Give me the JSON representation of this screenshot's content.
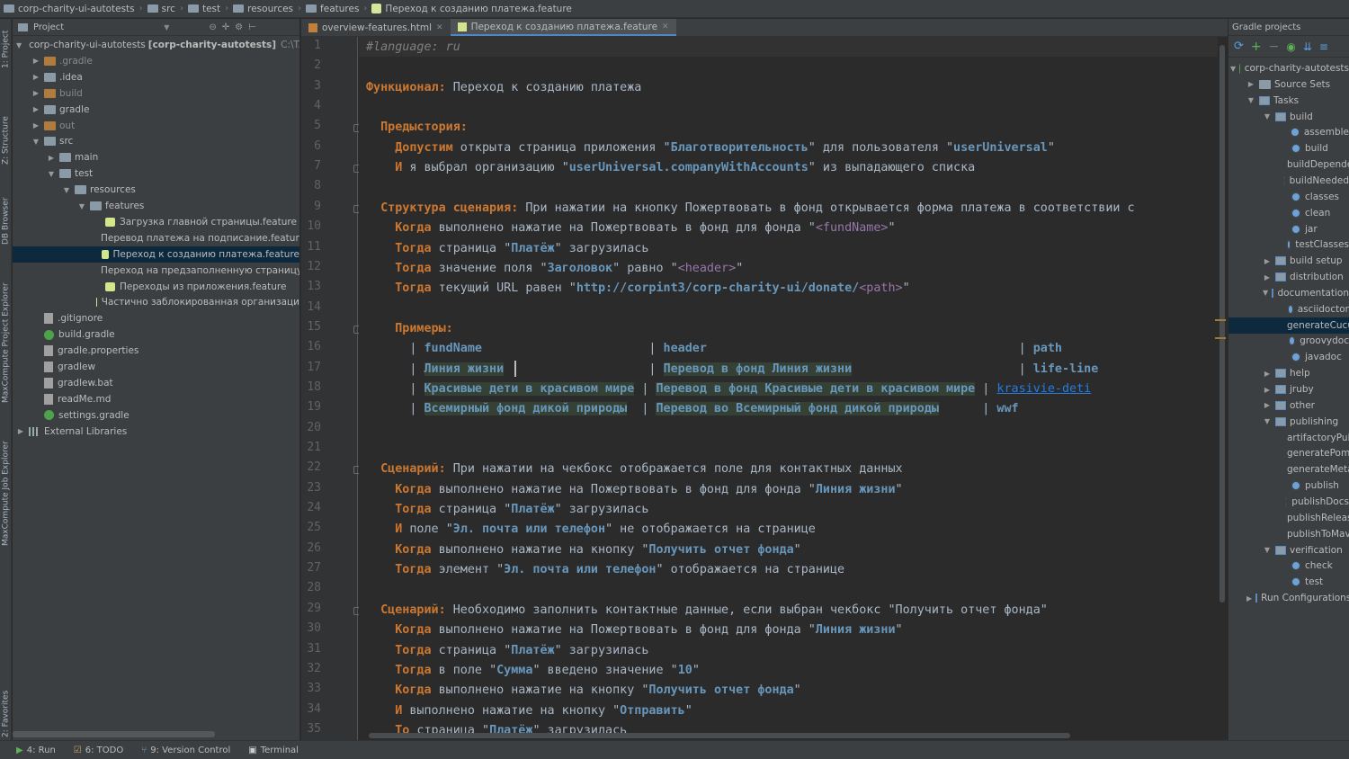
{
  "breadcrumbs": [
    "corp-charity-ui-autotests",
    "src",
    "test",
    "resources",
    "features",
    "Переход к созданию платежа.feature"
  ],
  "left_strip": [
    "1: Project",
    "Z: Structure",
    "DB Browser",
    "MaxCompute Project Explorer",
    "MaxCompute Job Explorer",
    "2: Favorites"
  ],
  "project_panel": {
    "title": "Project",
    "tree": [
      {
        "label": "corp-charity-ui-autotests",
        "suffix": "[corp-charity-autotests]",
        "path": "C:\\TAXE",
        "depth": 0,
        "icon": "folder",
        "expanded": true
      },
      {
        "label": ".gradle",
        "depth": 1,
        "icon": "folder-orange",
        "expanded": false
      },
      {
        "label": ".idea",
        "depth": 1,
        "icon": "folder",
        "expanded": false
      },
      {
        "label": "build",
        "depth": 1,
        "icon": "folder-orange",
        "expanded": false
      },
      {
        "label": "gradle",
        "depth": 1,
        "icon": "folder",
        "expanded": false
      },
      {
        "label": "out",
        "depth": 1,
        "icon": "folder-orange",
        "expanded": false
      },
      {
        "label": "src",
        "depth": 1,
        "icon": "folder",
        "expanded": true
      },
      {
        "label": "main",
        "depth": 2,
        "icon": "folder",
        "expanded": false
      },
      {
        "label": "test",
        "depth": 2,
        "icon": "folder",
        "expanded": true
      },
      {
        "label": "resources",
        "depth": 3,
        "icon": "folder",
        "expanded": true
      },
      {
        "label": "features",
        "depth": 4,
        "icon": "folder",
        "expanded": true
      },
      {
        "label": "Загрузка главной страницы.feature",
        "depth": 5,
        "icon": "feature"
      },
      {
        "label": "Перевод платежа на подписание.feature",
        "depth": 5,
        "icon": "feature"
      },
      {
        "label": "Переход к созданию платежа.feature",
        "depth": 5,
        "icon": "feature",
        "selected": true
      },
      {
        "label": "Переход на предзаполненную страницу",
        "depth": 5,
        "icon": "feature"
      },
      {
        "label": "Переходы из приложения.feature",
        "depth": 5,
        "icon": "feature"
      },
      {
        "label": "Частично заблокированная организаци",
        "depth": 5,
        "icon": "feature"
      },
      {
        "label": ".gitignore",
        "depth": 1,
        "icon": "file"
      },
      {
        "label": "build.gradle",
        "depth": 1,
        "icon": "gradle"
      },
      {
        "label": "gradle.properties",
        "depth": 1,
        "icon": "file"
      },
      {
        "label": "gradlew",
        "depth": 1,
        "icon": "file"
      },
      {
        "label": "gradlew.bat",
        "depth": 1,
        "icon": "file"
      },
      {
        "label": "readMe.md",
        "depth": 1,
        "icon": "file"
      },
      {
        "label": "settings.gradle",
        "depth": 1,
        "icon": "gradle"
      },
      {
        "label": "External Libraries",
        "depth": 0,
        "icon": "libs",
        "expanded": false
      }
    ]
  },
  "tabs": [
    {
      "label": "overview-features.html",
      "active": false
    },
    {
      "label": "Переход к созданию платежа.feature",
      "active": true
    }
  ],
  "editor": {
    "lines": [
      [
        [
          "cm",
          "#language: ru"
        ]
      ],
      [],
      [
        [
          "kw",
          "Функционал:"
        ],
        [
          "t",
          " Переход к созданию платежа"
        ]
      ],
      [],
      [
        [
          "t",
          "  "
        ],
        [
          "kw",
          "Предыстория:"
        ]
      ],
      [
        [
          "t",
          "    "
        ],
        [
          "kw",
          "Допустим"
        ],
        [
          "t",
          " открыта страница приложения "
        ],
        [
          "q",
          "\""
        ],
        [
          "pm",
          "Благотворительность"
        ],
        [
          "q",
          "\""
        ],
        [
          "t",
          " для пользователя "
        ],
        [
          "q",
          "\""
        ],
        [
          "pm",
          "userUniversal"
        ],
        [
          "q",
          "\""
        ]
      ],
      [
        [
          "t",
          "    "
        ],
        [
          "kw",
          "И"
        ],
        [
          "t",
          " я выбрал организацию "
        ],
        [
          "q",
          "\""
        ],
        [
          "pm",
          "userUniversal.companyWithAccounts"
        ],
        [
          "q",
          "\""
        ],
        [
          "t",
          " из выпадающего списка"
        ]
      ],
      [],
      [
        [
          "t",
          "  "
        ],
        [
          "kw",
          "Структура сценария:"
        ],
        [
          "t",
          " При нажатии на кнопку Пожертвовать в фонд открывается форма платежа в соответствии с"
        ]
      ],
      [
        [
          "t",
          "    "
        ],
        [
          "kw",
          "Когда"
        ],
        [
          "t",
          " выполнено нажатие на Пожертвовать в фонд для фонда "
        ],
        [
          "q",
          "\""
        ],
        [
          "ph",
          "<fundName>"
        ],
        [
          "q",
          "\""
        ]
      ],
      [
        [
          "t",
          "    "
        ],
        [
          "kw",
          "Тогда"
        ],
        [
          "t",
          " страница "
        ],
        [
          "q",
          "\""
        ],
        [
          "pm",
          "Платёж"
        ],
        [
          "q",
          "\""
        ],
        [
          "t",
          " загрузилась"
        ]
      ],
      [
        [
          "t",
          "    "
        ],
        [
          "kw",
          "Тогда"
        ],
        [
          "t",
          " значение поля "
        ],
        [
          "q",
          "\""
        ],
        [
          "pm",
          "Заголовок"
        ],
        [
          "q",
          "\""
        ],
        [
          "t",
          " равно "
        ],
        [
          "q",
          "\""
        ],
        [
          "ph",
          "<header>"
        ],
        [
          "q",
          "\""
        ]
      ],
      [
        [
          "t",
          "    "
        ],
        [
          "kw",
          "Тогда"
        ],
        [
          "t",
          " текущий URL равен "
        ],
        [
          "q",
          "\""
        ],
        [
          "pm",
          "http://corpint3/corp-charity-ui/donate/"
        ],
        [
          "ph",
          "<path>"
        ],
        [
          "q",
          "\""
        ]
      ],
      [],
      [
        [
          "t",
          "    "
        ],
        [
          "kw",
          "Примеры:"
        ]
      ],
      [
        [
          "t",
          "      | "
        ],
        [
          "pm",
          "fundName"
        ],
        [
          "t",
          "                       | "
        ],
        [
          "pm",
          "header"
        ],
        [
          "t",
          "                                           | "
        ],
        [
          "pm",
          "path"
        ]
      ],
      [
        [
          "t",
          "      | "
        ],
        [
          "pmh",
          "Линия жизни"
        ],
        [
          "t",
          "                    | "
        ],
        [
          "pmh",
          "Перевод в фонд Линия жизни"
        ],
        [
          "t",
          "                       | "
        ],
        [
          "pm",
          "life-line"
        ]
      ],
      [
        [
          "t",
          "      | "
        ],
        [
          "pmh",
          "Красивые дети в красивом мире"
        ],
        [
          "t",
          " | "
        ],
        [
          "pmh",
          "Перевод в фонд Красивые дети в красивом мире"
        ],
        [
          "t",
          " | "
        ],
        [
          "ul",
          "krasivie-deti"
        ]
      ],
      [
        [
          "t",
          "      | "
        ],
        [
          "pmh",
          "Всемирный фонд дикой природы"
        ],
        [
          "t",
          "  | "
        ],
        [
          "pmh",
          "Перевод во Всемирный фонд дикой природы"
        ],
        [
          "t",
          "      | "
        ],
        [
          "pm",
          "wwf"
        ]
      ],
      [],
      [],
      [
        [
          "t",
          "  "
        ],
        [
          "kw",
          "Сценарий:"
        ],
        [
          "t",
          " При нажатии на чекбокс отображается поле для контактных данных"
        ]
      ],
      [
        [
          "t",
          "    "
        ],
        [
          "kw",
          "Когда"
        ],
        [
          "t",
          " выполнено нажатие на Пожертвовать в фонд для фонда "
        ],
        [
          "q",
          "\""
        ],
        [
          "pm",
          "Линия жизни"
        ],
        [
          "q",
          "\""
        ]
      ],
      [
        [
          "t",
          "    "
        ],
        [
          "kw",
          "Тогда"
        ],
        [
          "t",
          " страница "
        ],
        [
          "q",
          "\""
        ],
        [
          "pm",
          "Платёж"
        ],
        [
          "q",
          "\""
        ],
        [
          "t",
          " загрузилась"
        ]
      ],
      [
        [
          "t",
          "    "
        ],
        [
          "kw",
          "И"
        ],
        [
          "t",
          " поле "
        ],
        [
          "q",
          "\""
        ],
        [
          "pm",
          "Эл. почта или телефон"
        ],
        [
          "q",
          "\""
        ],
        [
          "t",
          " не отображается на странице"
        ]
      ],
      [
        [
          "t",
          "    "
        ],
        [
          "kw",
          "Когда"
        ],
        [
          "t",
          " выполнено нажатие на кнопку "
        ],
        [
          "q",
          "\""
        ],
        [
          "pm",
          "Получить отчет фонда"
        ],
        [
          "q",
          "\""
        ]
      ],
      [
        [
          "t",
          "    "
        ],
        [
          "kw",
          "Тогда"
        ],
        [
          "t",
          " элемент "
        ],
        [
          "q",
          "\""
        ],
        [
          "pm",
          "Эл. почта или телефон"
        ],
        [
          "q",
          "\""
        ],
        [
          "t",
          " отображается на странице"
        ]
      ],
      [],
      [
        [
          "t",
          "  "
        ],
        [
          "kw",
          "Сценарий:"
        ],
        [
          "t",
          " Необходимо заполнить контактные данные, если выбран чекбокс \"Получить отчет фонда\""
        ]
      ],
      [
        [
          "t",
          "    "
        ],
        [
          "kw",
          "Когда"
        ],
        [
          "t",
          " выполнено нажатие на Пожертвовать в фонд для фонда "
        ],
        [
          "q",
          "\""
        ],
        [
          "pm",
          "Линия жизни"
        ],
        [
          "q",
          "\""
        ]
      ],
      [
        [
          "t",
          "    "
        ],
        [
          "kw",
          "Тогда"
        ],
        [
          "t",
          " страница "
        ],
        [
          "q",
          "\""
        ],
        [
          "pm",
          "Платёж"
        ],
        [
          "q",
          "\""
        ],
        [
          "t",
          " загрузилась"
        ]
      ],
      [
        [
          "t",
          "    "
        ],
        [
          "kw",
          "Тогда"
        ],
        [
          "t",
          " в поле "
        ],
        [
          "q",
          "\""
        ],
        [
          "pm",
          "Сумма"
        ],
        [
          "q",
          "\""
        ],
        [
          "t",
          " введено значение "
        ],
        [
          "q",
          "\""
        ],
        [
          "pm",
          "10"
        ],
        [
          "q",
          "\""
        ]
      ],
      [
        [
          "t",
          "    "
        ],
        [
          "kw",
          "Когда"
        ],
        [
          "t",
          " выполнено нажатие на кнопку "
        ],
        [
          "q",
          "\""
        ],
        [
          "pm",
          "Получить отчет фонда"
        ],
        [
          "q",
          "\""
        ]
      ],
      [
        [
          "t",
          "    "
        ],
        [
          "kw",
          "И"
        ],
        [
          "t",
          " выполнено нажатие на кнопку "
        ],
        [
          "q",
          "\""
        ],
        [
          "pm",
          "Отправить"
        ],
        [
          "q",
          "\""
        ]
      ],
      [
        [
          "t",
          "    "
        ],
        [
          "kw",
          "То"
        ],
        [
          "t",
          " страница "
        ],
        [
          "q",
          "\""
        ],
        [
          "pm",
          "Платёж"
        ],
        [
          "q",
          "\""
        ],
        [
          "t",
          " загрузилась"
        ]
      ]
    ]
  },
  "gradle_panel": {
    "title": "Gradle projects",
    "tree": [
      {
        "label": "corp-charity-autotests",
        "depth": 0,
        "icon": "project",
        "expanded": true
      },
      {
        "label": "Source Sets",
        "depth": 1,
        "icon": "folder",
        "expanded": false
      },
      {
        "label": "Tasks",
        "depth": 1,
        "icon": "tasks",
        "expanded": true
      },
      {
        "label": "build",
        "depth": 2,
        "icon": "tasks",
        "expanded": true
      },
      {
        "label": "assemble",
        "depth": 3,
        "icon": "gear"
      },
      {
        "label": "build",
        "depth": 3,
        "icon": "gear"
      },
      {
        "label": "buildDependents",
        "depth": 3,
        "icon": "gear"
      },
      {
        "label": "buildNeeded",
        "depth": 3,
        "icon": "gear"
      },
      {
        "label": "classes",
        "depth": 3,
        "icon": "gear"
      },
      {
        "label": "clean",
        "depth": 3,
        "icon": "gear"
      },
      {
        "label": "jar",
        "depth": 3,
        "icon": "gear"
      },
      {
        "label": "testClasses",
        "depth": 3,
        "icon": "gear"
      },
      {
        "label": "build setup",
        "depth": 2,
        "icon": "tasks",
        "expanded": false
      },
      {
        "label": "distribution",
        "depth": 2,
        "icon": "tasks",
        "expanded": false
      },
      {
        "label": "documentation",
        "depth": 2,
        "icon": "tasks",
        "expanded": true
      },
      {
        "label": "asciidoctor",
        "depth": 3,
        "icon": "gear"
      },
      {
        "label": "generateCucumberReports",
        "depth": 3,
        "icon": "gear",
        "selected": true
      },
      {
        "label": "groovydoc",
        "depth": 3,
        "icon": "gear"
      },
      {
        "label": "javadoc",
        "depth": 3,
        "icon": "gear"
      },
      {
        "label": "help",
        "depth": 2,
        "icon": "tasks",
        "expanded": false
      },
      {
        "label": "jruby",
        "depth": 2,
        "icon": "tasks",
        "expanded": false
      },
      {
        "label": "other",
        "depth": 2,
        "icon": "tasks",
        "expanded": false
      },
      {
        "label": "publishing",
        "depth": 2,
        "icon": "tasks",
        "expanded": true
      },
      {
        "label": "artifactoryPublish",
        "depth": 3,
        "icon": "gear"
      },
      {
        "label": "generatePomFile",
        "depth": 3,
        "icon": "gear"
      },
      {
        "label": "generateMetadata",
        "depth": 3,
        "icon": "gear"
      },
      {
        "label": "publish",
        "depth": 3,
        "icon": "gear"
      },
      {
        "label": "publishDocs",
        "depth": 3,
        "icon": "gear"
      },
      {
        "label": "publishRelease",
        "depth": 3,
        "icon": "gear"
      },
      {
        "label": "publishToMavenLocal",
        "depth": 3,
        "icon": "gear"
      },
      {
        "label": "verification",
        "depth": 2,
        "icon": "tasks",
        "expanded": true
      },
      {
        "label": "check",
        "depth": 3,
        "icon": "gear"
      },
      {
        "label": "test",
        "depth": 3,
        "icon": "gear"
      },
      {
        "label": "Run Configurations",
        "depth": 1,
        "icon": "tasks",
        "expanded": false
      }
    ]
  },
  "bottom_bar": [
    {
      "label": "4: Run",
      "icon": "run-icon"
    },
    {
      "label": "6: TODO",
      "icon": "todo-icon"
    },
    {
      "label": "9: Version Control",
      "icon": "vcs-icon"
    },
    {
      "label": "Terminal",
      "icon": "terminal-icon"
    }
  ],
  "colors": {
    "keyword": "#cc7832",
    "param": "#6897bb",
    "placeholder": "#9876aa",
    "comment": "#808080",
    "selection": "#0d293e"
  }
}
